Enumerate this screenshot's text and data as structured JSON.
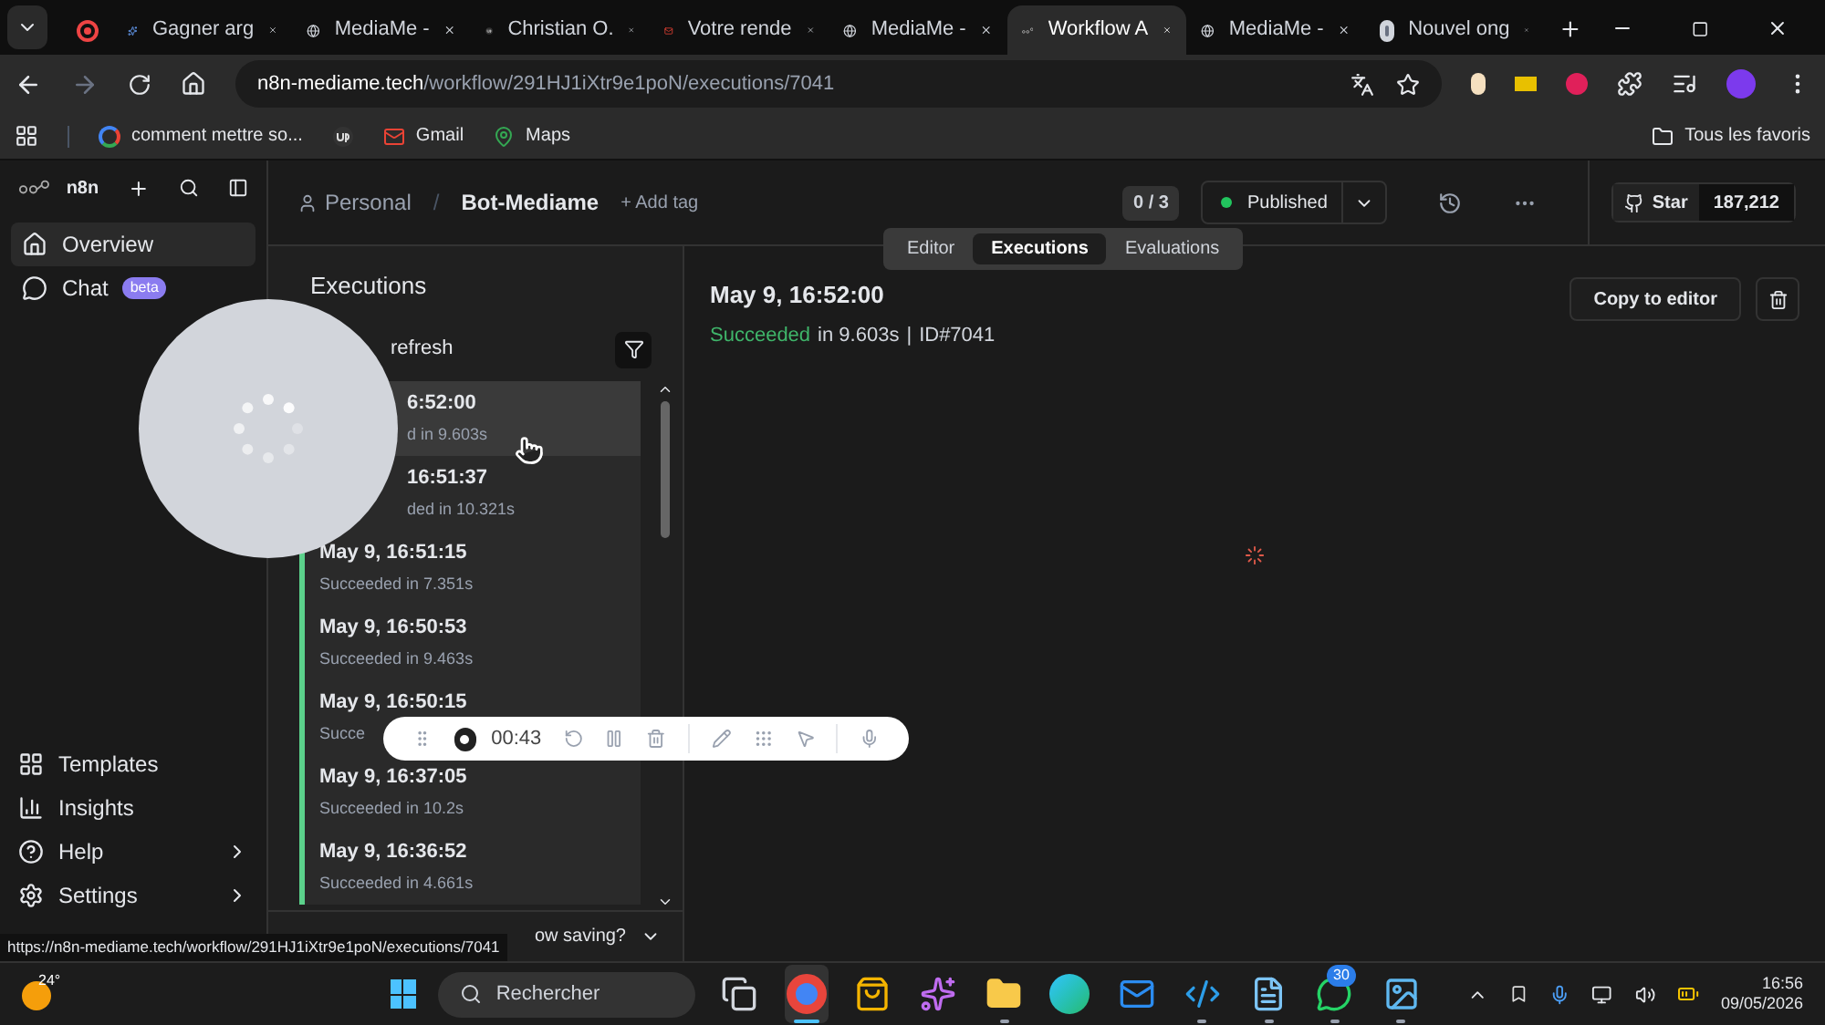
{
  "browser": {
    "tabs": [
      {
        "selected": false
      },
      {
        "title": "Gagner arg",
        "selected": false
      },
      {
        "title": "MediaMe -",
        "selected": false
      },
      {
        "title": "Christian O.",
        "selected": false
      },
      {
        "title": "Votre rende",
        "selected": false
      },
      {
        "title": "MediaMe -",
        "selected": false
      },
      {
        "title": "Workflow A",
        "selected": true
      },
      {
        "title": "MediaMe -",
        "selected": false
      },
      {
        "title": "Nouvel ong",
        "selected": false
      }
    ],
    "address": {
      "host": "n8n-mediame.tech",
      "path": "/workflow/291HJ1iXtr9e1poN/executions/7041"
    },
    "bookmarks": [
      {
        "label": "comment mettre so..."
      },
      {
        "label": "Gmail"
      },
      {
        "label": "Maps"
      }
    ],
    "bookmarks_folder": "Tous les favoris"
  },
  "app": {
    "brand": "n8n",
    "nav": [
      {
        "label": "Overview",
        "selected": true
      },
      {
        "label": "Chat",
        "badge": "beta",
        "selected": false
      }
    ],
    "bottom_nav": [
      {
        "label": "Templates",
        "submenu": false
      },
      {
        "label": "Insights",
        "submenu": false
      },
      {
        "label": "Help",
        "submenu": true
      },
      {
        "label": "Settings",
        "submenu": true
      }
    ],
    "breadcrumb": {
      "project": "Personal",
      "separator": "/",
      "workflow": "Bot-Mediame",
      "add_tag": "+ Add tag"
    },
    "counter": "0 / 3",
    "publish": "Published",
    "star": {
      "label": "Star",
      "count": "187,212"
    },
    "view_tabs": [
      {
        "label": "Editor",
        "selected": false
      },
      {
        "label": "Executions",
        "selected": true
      },
      {
        "label": "Evaluations",
        "selected": false
      }
    ],
    "executions": {
      "title": "Executions",
      "auto_refresh": "refresh",
      "items": [
        {
          "time": "6:52:00",
          "status": "d in 9.603s",
          "selected": true,
          "partly_hidden": true
        },
        {
          "time": "16:51:37",
          "status": "ded in 10.321s",
          "selected": false,
          "partly_hidden": true
        },
        {
          "time": "May 9, 16:51:15",
          "status": "Succeeded in 7.351s",
          "selected": false,
          "partly_hidden": false
        },
        {
          "time": "May 9, 16:50:53",
          "status": "Succeeded in 9.463s",
          "selected": false,
          "partly_hidden": false
        },
        {
          "time": "May 9, 16:50:15",
          "status": "Succe",
          "selected": false,
          "partly_hidden": false
        },
        {
          "time": "May 9, 16:37:05",
          "status": "Succeeded in 10.2s",
          "selected": false,
          "partly_hidden": false
        },
        {
          "time": "May 9, 16:36:52",
          "status": "Succeeded in 4.661s",
          "selected": false,
          "partly_hidden": false
        }
      ],
      "footer_hint": "ow saving?"
    },
    "detail": {
      "time": "May 9, 16:52:00",
      "status": "Succeeded",
      "duration": "in 9.603s",
      "separator": "|",
      "id": "ID#7041",
      "copy": "Copy to editor"
    }
  },
  "recorder": {
    "time": "00:43"
  },
  "status_url": "https://n8n-mediame.tech/workflow/291HJ1iXtr9e1poN/executions/7041",
  "taskbar": {
    "weather": "24°",
    "search": "Rechercher",
    "apps": [
      {
        "selected": false,
        "running": false
      },
      {
        "selected": true,
        "running": true
      },
      {
        "selected": false,
        "running": false
      },
      {
        "selected": false,
        "running": false
      },
      {
        "selected": false,
        "running": true
      },
      {
        "selected": false,
        "running": false
      },
      {
        "selected": false,
        "running": false
      },
      {
        "selected": false,
        "running": true
      },
      {
        "selected": false,
        "running": true
      },
      {
        "selected": false,
        "running": true,
        "badge": "30"
      },
      {
        "selected": false,
        "running": true
      }
    ],
    "time": "16:56",
    "date": "09/05/2026"
  }
}
